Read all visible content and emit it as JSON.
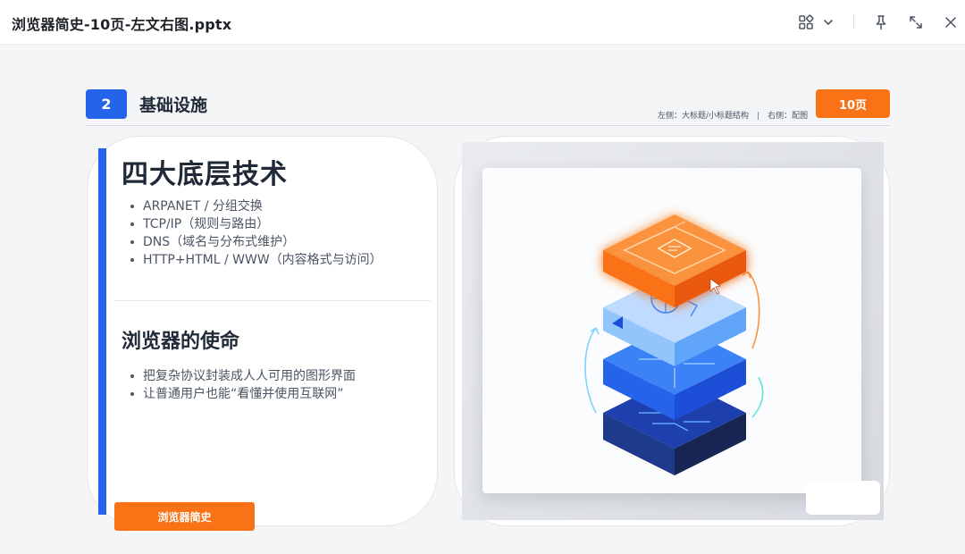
{
  "window": {
    "title": "浏览器简史-10页-左文右图.pptx",
    "icons": [
      "grid-view-icon",
      "chevron-down-icon",
      "pin-icon",
      "expand-icon",
      "close-icon"
    ]
  },
  "slide": {
    "section_number": "2",
    "section_title": "基础设施",
    "page_badge": "10页",
    "hint_left": "左侧：大标题/小标题结构",
    "hint_separator": "|",
    "hint_right": "右侧：配图",
    "heading_main": "四大底层技术",
    "bullets_main": [
      "ARPANET / 分组交换",
      "TCP/IP（规则与路由）",
      "DNS（域名与分布式维护）",
      "HTTP+HTML / WWW（内容格式与访问）"
    ],
    "heading_sub": "浏览器的使命",
    "bullets_sub": [
      "把复杂协议封装成人人可用的图形界面",
      "让普通用户也能“看懂并使用互联网”"
    ],
    "footer_badge": "浏览器简史"
  },
  "colors": {
    "accent_blue": "#2563eb",
    "accent_orange": "#f97316",
    "text_dark": "#1f2937",
    "text_muted": "#4b5563"
  }
}
